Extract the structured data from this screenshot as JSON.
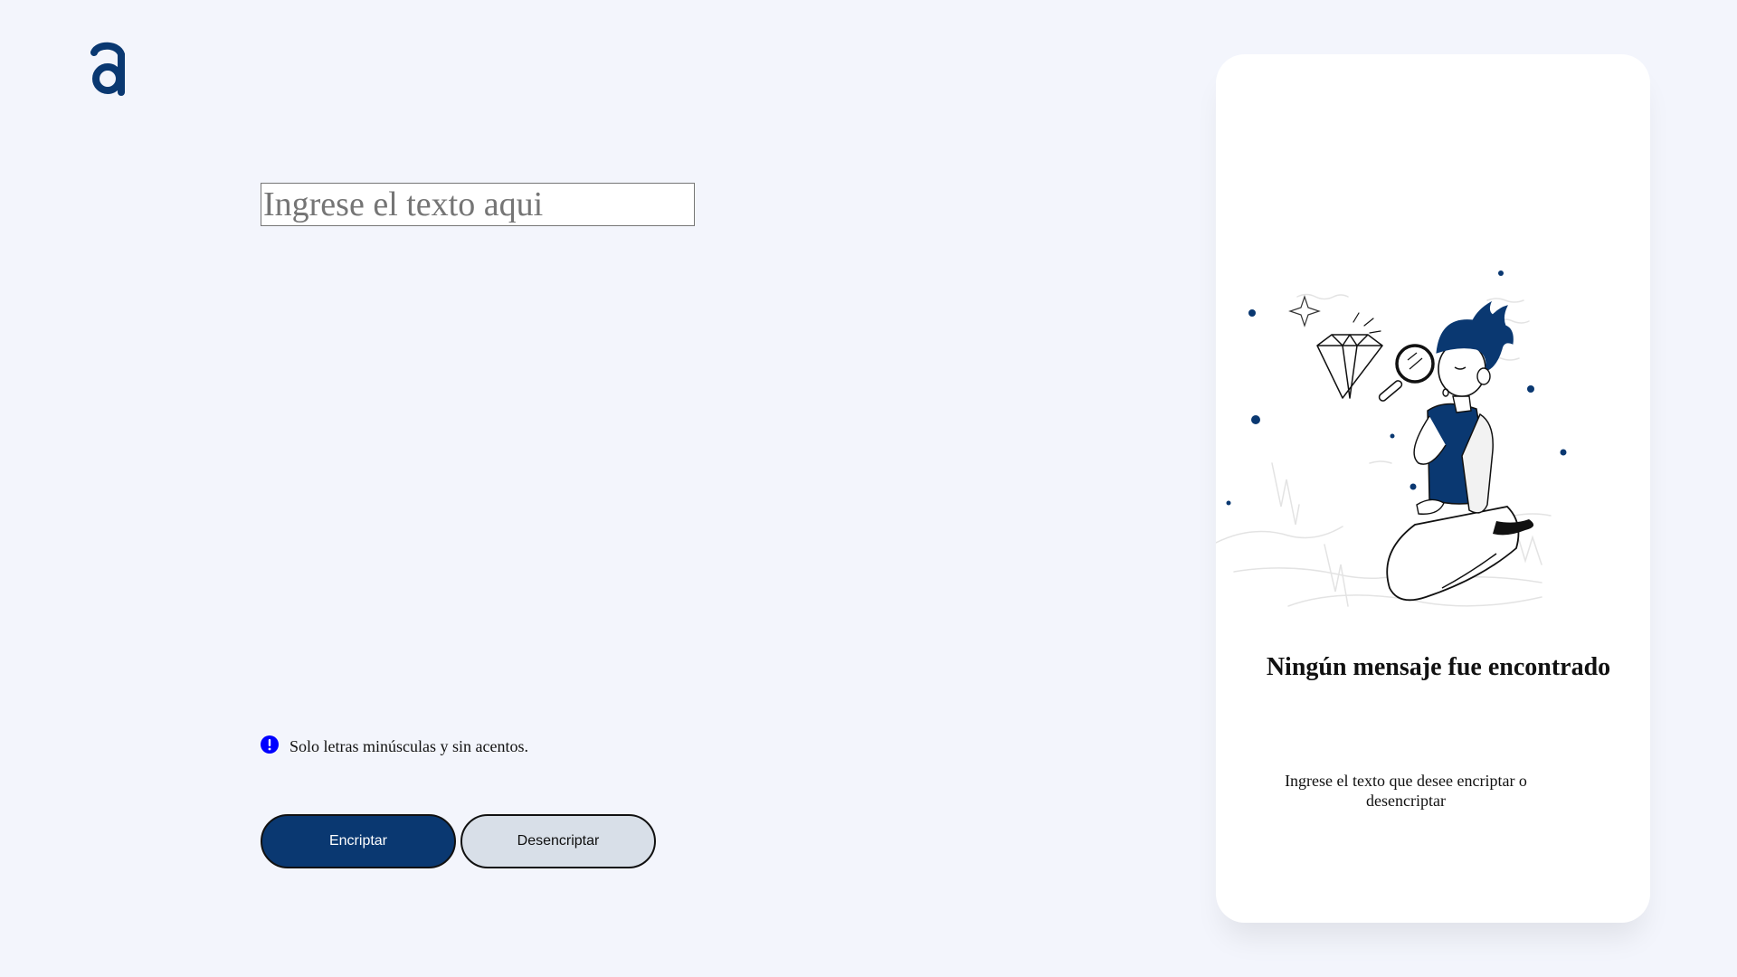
{
  "logo": {
    "icon": "alura-a-logo-icon",
    "color": "#0a3871"
  },
  "input": {
    "placeholder": "Ingrese el texto aqui",
    "value": ""
  },
  "hint": {
    "icon": "exclamation-circle-icon",
    "icon_color": "#0000ff",
    "text": "Solo letras minúsculas y sin acentos."
  },
  "buttons": {
    "encrypt_label": "Encriptar",
    "decrypt_label": "Desencriptar"
  },
  "result": {
    "illustration": "person-with-magnifying-glass-illustration",
    "title": "Ningún mensaje fue encontrado",
    "subtitle": "Ingrese el texto que desee encriptar o desencriptar"
  },
  "colors": {
    "background": "#f3f5fc",
    "primary": "#0a3871",
    "secondary_button": "#d8dfe8",
    "panel": "#ffffff"
  }
}
